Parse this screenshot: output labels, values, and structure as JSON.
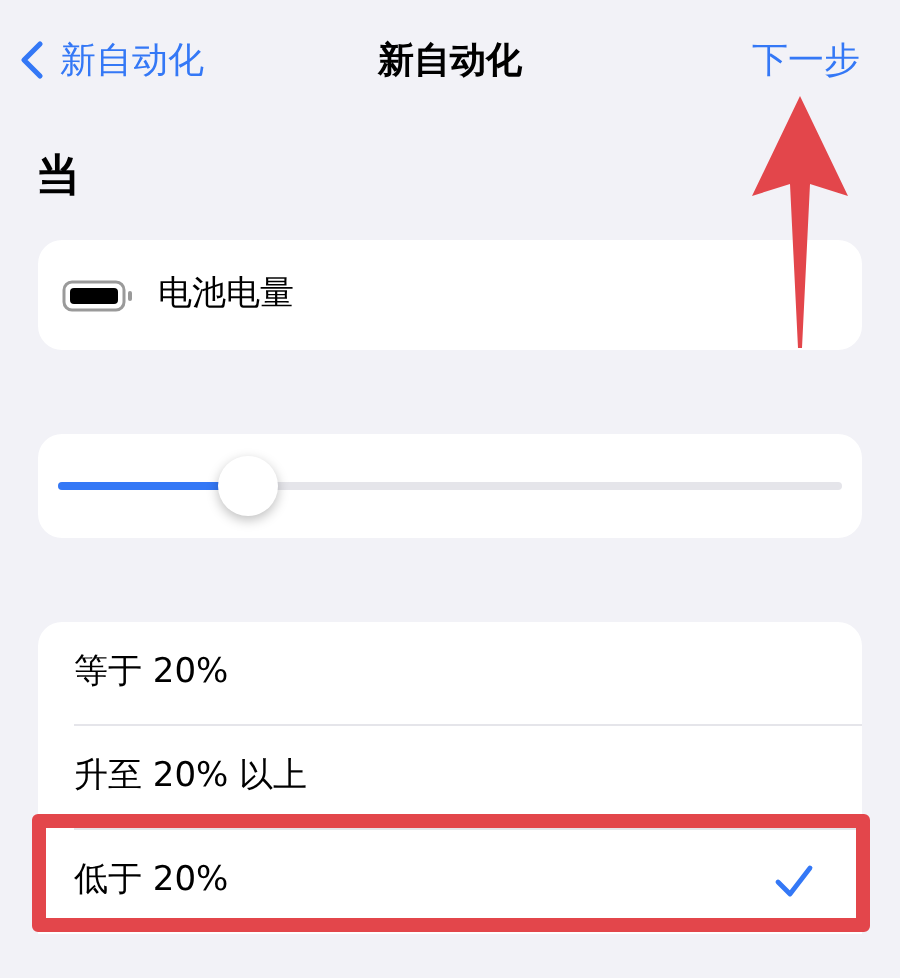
{
  "nav": {
    "back_label": "新自动化",
    "title": "新自动化",
    "next_label": "下一步",
    "next_arrow": true
  },
  "section_title": "当",
  "trigger": {
    "label": "电池电量"
  },
  "slider": {
    "level": 0.22
  },
  "options": [
    {
      "label": "等于 20%",
      "selected": false,
      "highlighted": false
    },
    {
      "label": "升至 20% 以上",
      "selected": false,
      "highlighted": false
    },
    {
      "label": "低于 20%",
      "selected": true,
      "highlighted": true
    }
  ]
}
